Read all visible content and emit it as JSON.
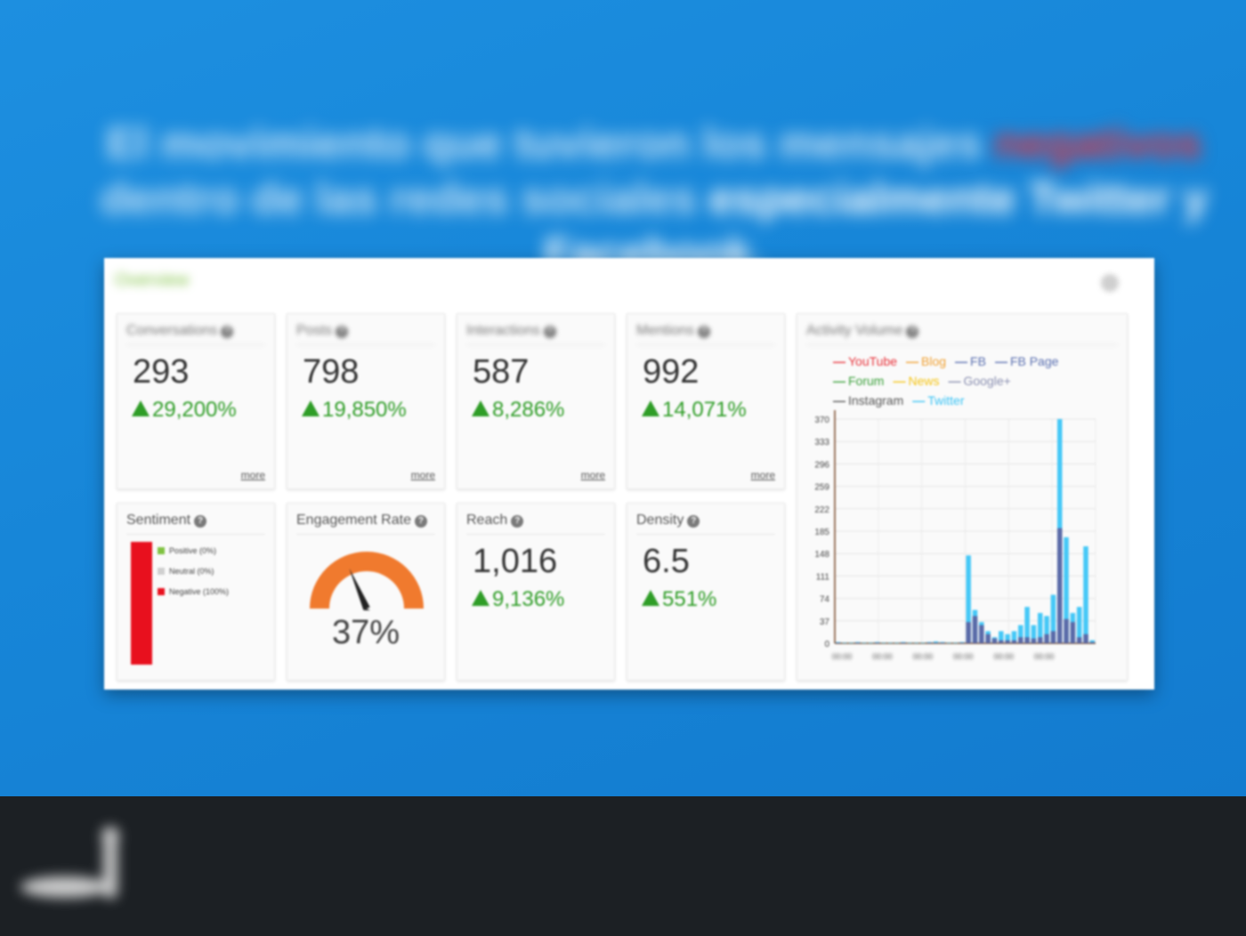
{
  "headline": {
    "part1": "El movimiento que tuvieron los mensajes ",
    "negative_word": "negativos",
    "part2": " dentro de las redes sociales ",
    "strong_part": "especialmente Twitter y Facebook."
  },
  "panel": {
    "title": "Overview"
  },
  "kpis": [
    {
      "label": "Conversations",
      "value": "293",
      "delta": "29,200%",
      "more": "more"
    },
    {
      "label": "Posts",
      "value": "798",
      "delta": "19,850%",
      "more": "more"
    },
    {
      "label": "Interactions",
      "value": "587",
      "delta": "8,286%",
      "more": "more"
    },
    {
      "label": "Mentions",
      "value": "992",
      "delta": "14,071%",
      "more": "more"
    }
  ],
  "sentiment": {
    "label": "Sentiment",
    "legend": [
      {
        "text": "Positive (0%)",
        "color": "#7fc241"
      },
      {
        "text": "Neutral (0%)",
        "color": "#cfcfcf"
      },
      {
        "text": "Negative (100%)",
        "color": "#e8101e"
      }
    ],
    "negative_fraction": 1.0
  },
  "engagement": {
    "label": "Engagement Rate",
    "value": "37%",
    "fraction": 0.37,
    "gauge_color": "#f07a2e"
  },
  "reach": {
    "label": "Reach",
    "value": "1,016",
    "delta": "9,136%"
  },
  "density": {
    "label": "Density",
    "value": "6.5",
    "delta": "551%"
  },
  "chart_data": {
    "type": "bar",
    "title": "Activity Volume",
    "legend_position": "top",
    "series_legend": [
      {
        "name": "YouTube",
        "color": "#e8343c"
      },
      {
        "name": "Blog",
        "color": "#f0a030"
      },
      {
        "name": "FB",
        "color": "#5a6fb0"
      },
      {
        "name": "FB Page",
        "color": "#5a6fb0"
      },
      {
        "name": "Forum",
        "color": "#3aa03a"
      },
      {
        "name": "News",
        "color": "#f5c518"
      },
      {
        "name": "Google+",
        "color": "#8a8fb0"
      },
      {
        "name": "Instagram",
        "color": "#555555"
      },
      {
        "name": "Twitter",
        "color": "#3cc4f5"
      }
    ],
    "yticks": [
      0,
      37,
      74,
      111,
      148,
      185,
      222,
      259,
      296,
      333,
      370
    ],
    "ylim": [
      0,
      370
    ],
    "grid": true,
    "xtick_labels": [
      "00:00",
      "00:00",
      "00:00",
      "00:00",
      "00:00",
      "00:00"
    ],
    "series": [
      {
        "name": "Twitter",
        "values": [
          2,
          1,
          1,
          2,
          1,
          1,
          2,
          1,
          1,
          1,
          2,
          1,
          1,
          1,
          2,
          3,
          2,
          1,
          1,
          2,
          145,
          55,
          35,
          20,
          10,
          20,
          15,
          20,
          30,
          60,
          30,
          50,
          45,
          80,
          370,
          175,
          50,
          60,
          160,
          5
        ]
      },
      {
        "name": "FB",
        "values": [
          1,
          0,
          0,
          1,
          0,
          0,
          1,
          0,
          0,
          0,
          1,
          0,
          0,
          0,
          1,
          1,
          1,
          0,
          0,
          1,
          35,
          45,
          30,
          15,
          8,
          5,
          5,
          5,
          10,
          10,
          8,
          10,
          15,
          20,
          190,
          40,
          35,
          10,
          15,
          2
        ]
      }
    ]
  }
}
